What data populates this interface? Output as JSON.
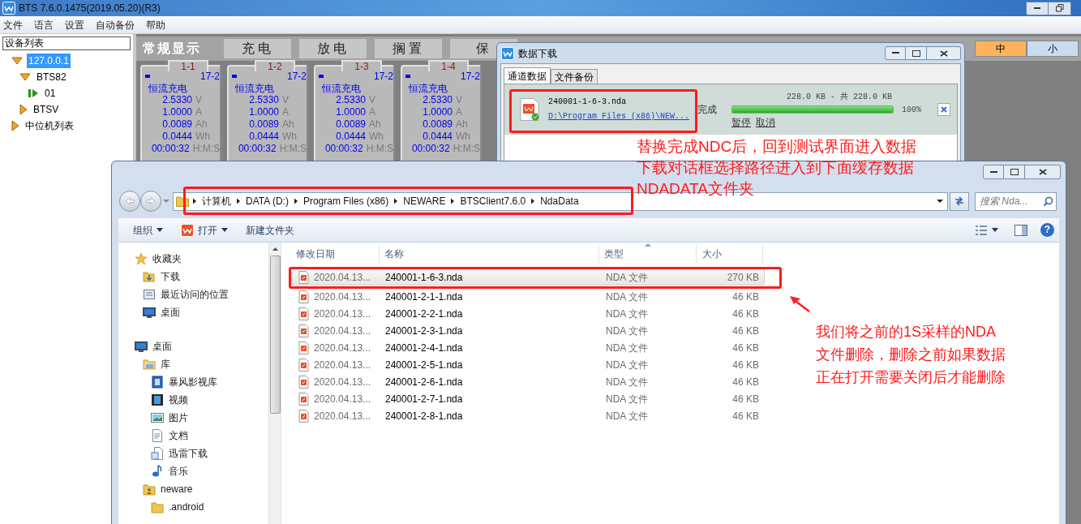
{
  "main_window": {
    "title": "BTS 7.6.0.1475(2019.05.20)(R3)",
    "menu": [
      "文件",
      "语言",
      "设置",
      "自动备份",
      "帮助"
    ],
    "device_panel": {
      "title": "设备列表",
      "tree": [
        {
          "label": "127.0.0.1",
          "kind": "group",
          "expanded": true,
          "selected": true,
          "children": [
            {
              "label": "BTS82",
              "kind": "group",
              "expanded": true,
              "selected": false,
              "children": [
                {
                  "label": "01",
                  "kind": "channel",
                  "selected": false
                }
              ]
            },
            {
              "label": "BTSV",
              "kind": "group",
              "expanded": false,
              "selected": false
            }
          ]
        },
        {
          "label": "中位机列表",
          "kind": "group",
          "expanded": false,
          "selected": false
        }
      ]
    },
    "view_tabs": [
      {
        "label": "常规显示",
        "selected": true
      },
      {
        "label": "充电",
        "selected": false
      },
      {
        "label": "放电",
        "selected": false
      },
      {
        "label": "搁置",
        "selected": false
      },
      {
        "label": "保",
        "selected": false
      }
    ],
    "size_buttons": [
      {
        "label": "中",
        "selected": true
      },
      {
        "label": "小",
        "selected": false
      }
    ],
    "channels": [
      {
        "id": "1-1",
        "step": "17-2",
        "mode": "恒流充电",
        "readings": [
          {
            "value": "2.5330",
            "unit": "V"
          },
          {
            "value": "1.0000",
            "unit": "A"
          },
          {
            "value": "0.0089",
            "unit": "Ah"
          },
          {
            "value": "0.0444",
            "unit": "Wh"
          },
          {
            "value": "00:00:32",
            "unit": "H:M:S"
          }
        ]
      },
      {
        "id": "1-2",
        "step": "17-2",
        "mode": "恒流充电",
        "readings": [
          {
            "value": "2.5330",
            "unit": "V"
          },
          {
            "value": "1.0000",
            "unit": "A"
          },
          {
            "value": "0.0089",
            "unit": "Ah"
          },
          {
            "value": "0.0444",
            "unit": "Wh"
          },
          {
            "value": "00:00:32",
            "unit": "H:M:S"
          }
        ]
      },
      {
        "id": "1-3",
        "step": "17-2",
        "mode": "恒流充电",
        "readings": [
          {
            "value": "2.5330",
            "unit": "V"
          },
          {
            "value": "1.0000",
            "unit": "A"
          },
          {
            "value": "0.0089",
            "unit": "Ah"
          },
          {
            "value": "0.0444",
            "unit": "Wh"
          },
          {
            "value": "00:00:32",
            "unit": "H:M:S"
          }
        ]
      },
      {
        "id": "1-4",
        "step": "17-2",
        "mode": "恒流充电",
        "readings": [
          {
            "value": "2.5330",
            "unit": "V"
          },
          {
            "value": "1.0000",
            "unit": "A"
          },
          {
            "value": "0.0089",
            "unit": "Ah"
          },
          {
            "value": "0.0444",
            "unit": "Wh"
          },
          {
            "value": "00:00:32",
            "unit": "H:M:S"
          }
        ]
      }
    ]
  },
  "download_dialog": {
    "title": "数据下载",
    "tabs": [
      {
        "label": "通道数据",
        "selected": true
      },
      {
        "label": "文件备份",
        "selected": false
      }
    ],
    "downloads": [
      {
        "file": "240001-1-6-3.nda",
        "path": "D:\\Program Files (x86)\\NEW...",
        "status": "完成",
        "size": "228.0 KB - 共 228.0 KB",
        "level": 1,
        "percent": "100%",
        "actions": [
          "暂停",
          "取消"
        ]
      }
    ]
  },
  "explorer": {
    "breadcrumb": [
      "计算机",
      "DATA (D:)",
      "Program Files (x86)",
      "NEWARE",
      "BTSClient7.6.0",
      "NdaData"
    ],
    "search_placeholder": "搜索 Nda...",
    "toolbar": [
      {
        "label": "组织",
        "menu": true
      },
      {
        "label": "打开",
        "menu": true
      },
      {
        "label": "新建文件夹",
        "menu": false
      }
    ],
    "help_label": "?",
    "nav": [
      {
        "label": "收藏夹",
        "children": [
          {
            "label": "下载"
          },
          {
            "label": "最近访问的位置"
          },
          {
            "label": "桌面"
          }
        ]
      },
      {
        "label": "桌面",
        "children": [
          {
            "label": "库",
            "children": [
              {
                "label": "暴风影视库"
              },
              {
                "label": "视频"
              },
              {
                "label": "图片"
              },
              {
                "label": "文档"
              },
              {
                "label": "迅雷下载"
              },
              {
                "label": "音乐"
              }
            ]
          },
          {
            "label": "neware",
            "children": [
              {
                "label": ".android"
              }
            ]
          }
        ]
      }
    ],
    "columns": [
      {
        "label": "修改日期",
        "sorted": false
      },
      {
        "label": "名称",
        "sorted": false
      },
      {
        "label": "类型",
        "sorted": true
      },
      {
        "label": "大小",
        "sorted": false
      }
    ],
    "rows": [
      {
        "date": "2020.04.13...",
        "name": "240001-1-6-3.nda",
        "type": "NDA 文件",
        "size": "270 KB",
        "selected": true
      },
      {
        "date": "2020.04.13...",
        "name": "240001-2-1-1.nda",
        "type": "NDA 文件",
        "size": "46 KB",
        "selected": false
      },
      {
        "date": "2020.04.13...",
        "name": "240001-2-2-1.nda",
        "type": "NDA 文件",
        "size": "46 KB",
        "selected": false
      },
      {
        "date": "2020.04.13...",
        "name": "240001-2-3-1.nda",
        "type": "NDA 文件",
        "size": "46 KB",
        "selected": false
      },
      {
        "date": "2020.04.13...",
        "name": "240001-2-4-1.nda",
        "type": "NDA 文件",
        "size": "46 KB",
        "selected": false
      },
      {
        "date": "2020.04.13...",
        "name": "240001-2-5-1.nda",
        "type": "NDA 文件",
        "size": "46 KB",
        "selected": false
      },
      {
        "date": "2020.04.13...",
        "name": "240001-2-6-1.nda",
        "type": "NDA 文件",
        "size": "46 KB",
        "selected": false
      },
      {
        "date": "2020.04.13...",
        "name": "240001-2-7-1.nda",
        "type": "NDA 文件",
        "size": "46 KB",
        "selected": false
      },
      {
        "date": "2020.04.13...",
        "name": "240001-2-8-1.nda",
        "type": "NDA 文件",
        "size": "46 KB",
        "selected": false
      }
    ]
  },
  "annotations": [
    {
      "lines": [
        "替换完成NDC后，回到测试界面进入数据",
        "下载对话框选择路径进入到下面缓存数据",
        "NDADATA文件夹"
      ]
    },
    {
      "lines": [
        "我们将之前的1S采样的NDA",
        "文件删除，删除之前如果数据",
        "正在打开需要关闭后才能删除"
      ]
    }
  ]
}
